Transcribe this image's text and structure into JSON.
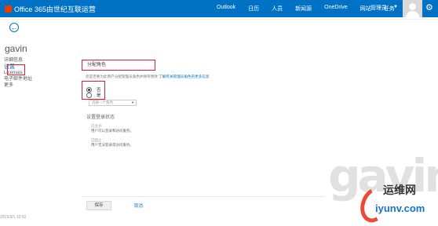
{
  "header": {
    "brand": "Office 365由世纪互联运营",
    "nav": [
      "Outlook",
      "日历",
      "人员",
      "新闻源",
      "OneDrive",
      "网站",
      "任务"
    ],
    "admin_label": "管理员"
  },
  "user": {
    "name": "gavin"
  },
  "sidebar": {
    "items": [
      {
        "label": "详细信息",
        "active": false
      },
      {
        "label": "设置",
        "active": true
      },
      {
        "label": "Licenses",
        "active": false
      },
      {
        "label": "电子邮件地址",
        "active": false
      },
      {
        "label": "更多",
        "active": false
      }
    ]
  },
  "main": {
    "section_title": "分配角色",
    "description": "您是否要为此用户分配管理员角色并保存更改",
    "description_link": "了解有关管理员角色的更多信息",
    "radio_yes": "否",
    "radio_no": "是",
    "select_placeholder": "选择一个角色",
    "status_title": "设置登录状态",
    "allowed_title": "已允许",
    "allowed_desc": "用户可以登录和访问服务。",
    "blocked_title": "已阻止",
    "blocked_desc": "用户无法登录或访问服务。",
    "save": "保存",
    "cancel": "取消",
    "corner_note": "2015/3/1 10:02"
  },
  "watermark": {
    "big": "gavin",
    "cn": "运维网",
    "domain": "iyunv.com"
  }
}
